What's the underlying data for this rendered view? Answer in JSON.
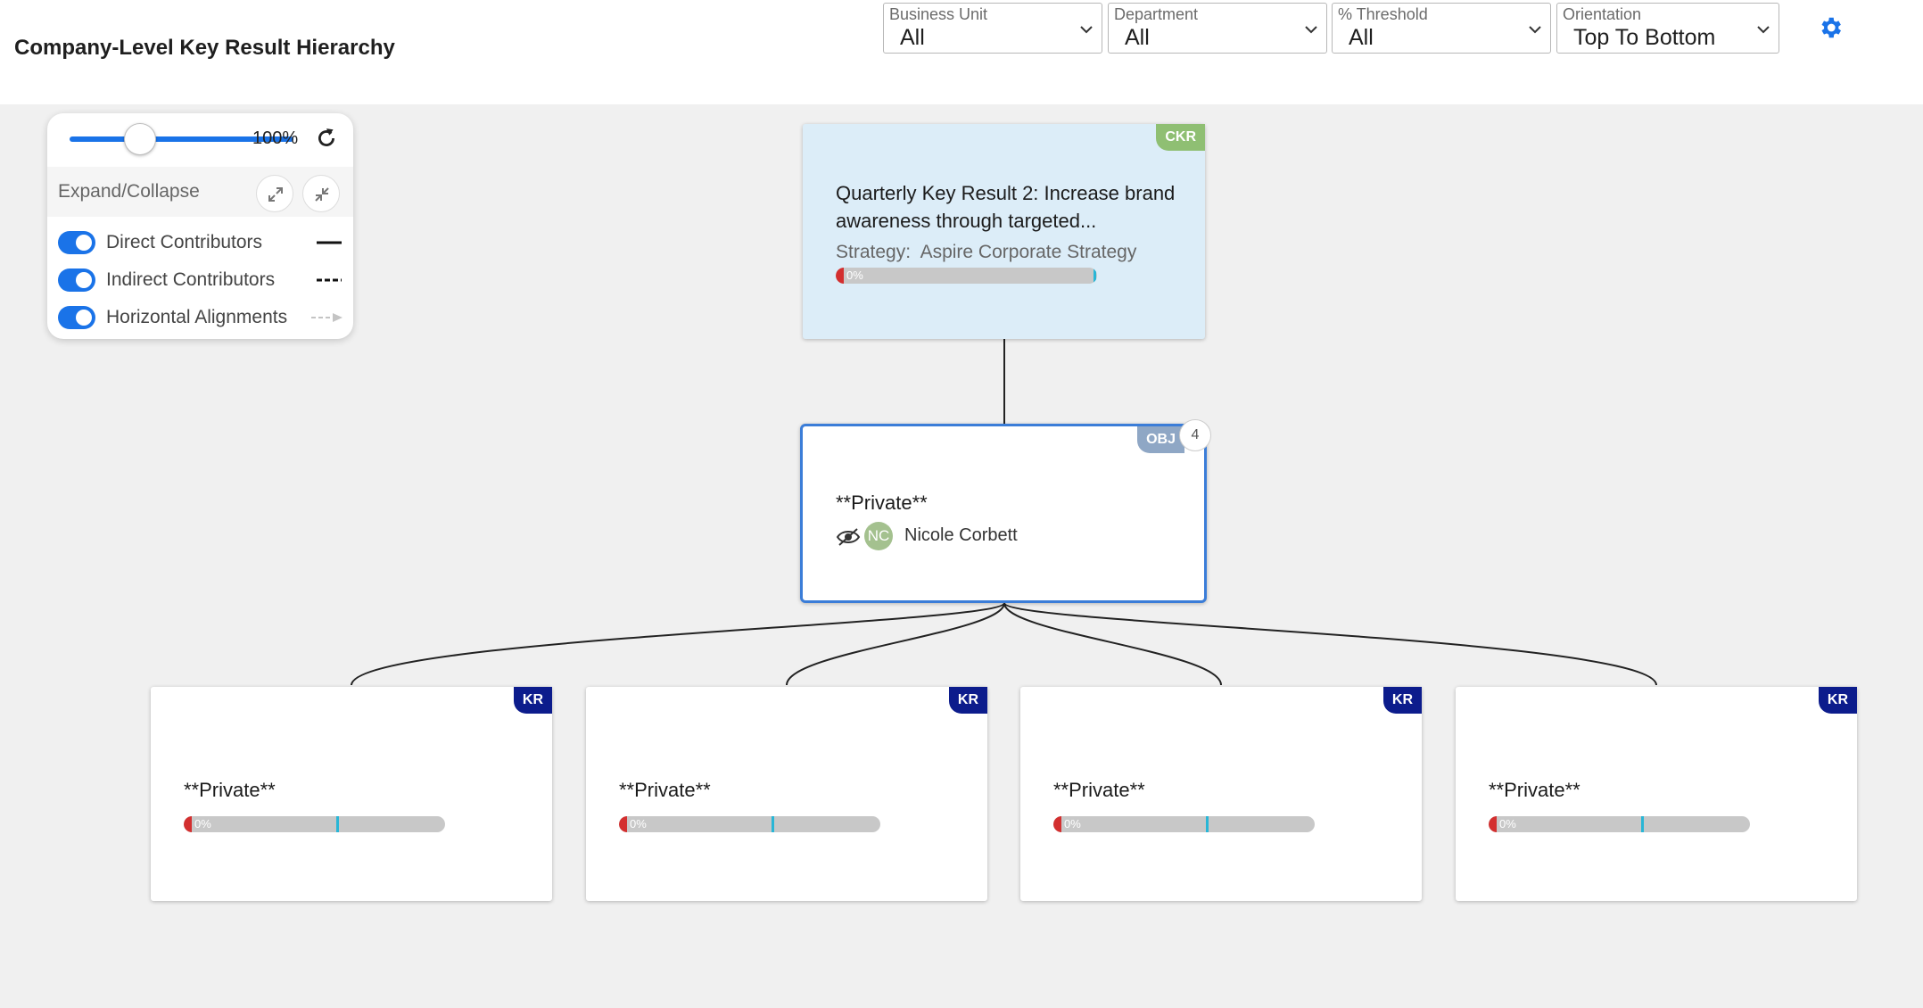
{
  "header": {
    "title": "Company-Level Key Result Hierarchy",
    "filters": [
      {
        "label": "Business Unit",
        "value": "All"
      },
      {
        "label": "Department",
        "value": "All"
      },
      {
        "label": "% Threshold",
        "value": "All"
      },
      {
        "label": "Orientation",
        "value": "Top To Bottom"
      }
    ],
    "settings_icon": "gear-icon",
    "accent_color": "#1a73e8"
  },
  "controls": {
    "zoom": "100%",
    "zoom_fraction": 0.3,
    "expand_collapse_label": "Expand/Collapse",
    "toggles": [
      {
        "label": "Direct Contributors",
        "on": true,
        "legend": "solid"
      },
      {
        "label": "Indirect Contributors",
        "on": true,
        "legend": "dashed"
      },
      {
        "label": "Horizontal Alignments",
        "on": true,
        "legend": "arrow"
      }
    ]
  },
  "ckr_node": {
    "badge": "CKR",
    "title_line1": "Quarterly Key Result 2: Increase brand",
    "title_line2": "awareness through targeted...",
    "strategy_label": "Strategy:",
    "strategy_value": "Aspire Corporate Strategy",
    "progress": "0%"
  },
  "obj_node": {
    "badge": "OBJ",
    "child_count": "4",
    "title": "**Private**",
    "owner_initials": "NC",
    "owner_name": "Nicole Corbett"
  },
  "kr_nodes": [
    {
      "badge": "KR",
      "title": "**Private**",
      "progress": "0%"
    },
    {
      "badge": "KR",
      "title": "**Private**",
      "progress": "0%"
    },
    {
      "badge": "KR",
      "title": "**Private**",
      "progress": "0%"
    },
    {
      "badge": "KR",
      "title": "**Private**",
      "progress": "0%"
    }
  ]
}
